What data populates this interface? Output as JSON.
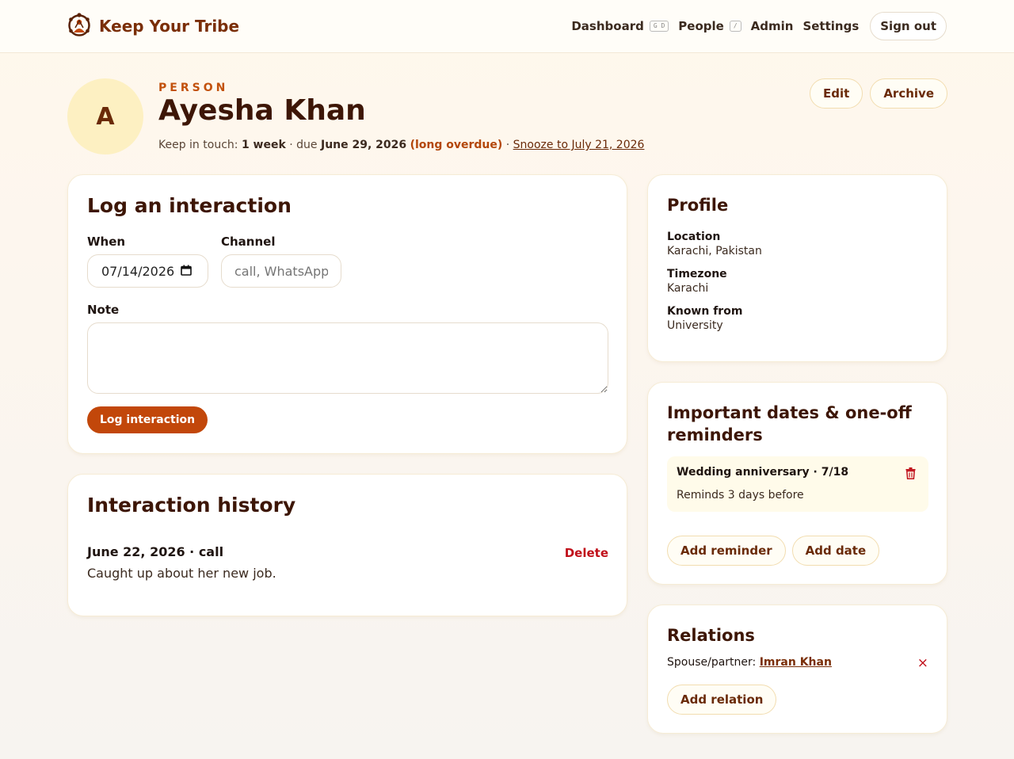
{
  "app": {
    "title": "Keep Your Tribe"
  },
  "nav": {
    "dashboard": "Dashboard",
    "dashboard_kbd": "G D",
    "people": "People",
    "people_kbd": "/",
    "admin": "Admin",
    "settings": "Settings",
    "signout": "Sign out"
  },
  "person": {
    "initial": "A",
    "eyebrow": "PERSON",
    "name": "Ayesha Khan",
    "keep_prefix": "Keep in touch:",
    "cadence": "1 week",
    "due_prefix": "· due",
    "due_date": "June 29, 2026",
    "overdue": "(long overdue)",
    "sep": "·",
    "snooze": "Snooze to July 21, 2026",
    "edit": "Edit",
    "archive": "Archive"
  },
  "log": {
    "title": "Log an interaction",
    "when_label": "When",
    "when_value": "07/14/2026",
    "channel_label": "Channel",
    "channel_placeholder": "call, WhatsApp",
    "note_label": "Note",
    "submit": "Log interaction"
  },
  "history": {
    "title": "Interaction history",
    "items": [
      {
        "header": "June 22, 2026 · call",
        "note": "Caught up about her new job.",
        "delete": "Delete"
      }
    ]
  },
  "profile": {
    "title": "Profile",
    "fields": [
      {
        "label": "Location",
        "value": "Karachi, Pakistan"
      },
      {
        "label": "Timezone",
        "value": "Karachi"
      },
      {
        "label": "Known from",
        "value": "University"
      }
    ]
  },
  "dates": {
    "title": "Important dates & one-off reminders",
    "items": [
      {
        "title": "Wedding anniversary · 7/18",
        "sub": "Reminds 3 days before"
      }
    ],
    "add_reminder": "Add reminder",
    "add_date": "Add date"
  },
  "relations": {
    "title": "Relations",
    "items": [
      {
        "type": "Spouse/partner:",
        "name": "Imran Khan",
        "remove": "×"
      }
    ],
    "add": "Add relation"
  },
  "colors": {
    "accent": "#c2470a",
    "brand": "#7a2e08",
    "danger": "#c0101a"
  }
}
